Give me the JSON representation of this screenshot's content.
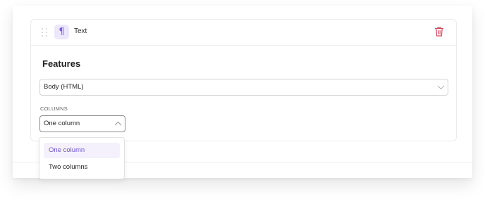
{
  "block": {
    "type_icon": "paragraph-icon",
    "type_label": "Text",
    "delete_icon": "trash-icon"
  },
  "section": {
    "title": "Features"
  },
  "body_select": {
    "value": "Body (HTML)"
  },
  "columns": {
    "label": "COLUMNS",
    "value": "One column",
    "options": [
      "One column",
      "Two columns"
    ],
    "selected_index": 0
  },
  "colors": {
    "accent": "#7a60d6",
    "accent_bg": "#ece7fb",
    "delete": "#d44a5e",
    "option_active_bg": "#f4f1fd"
  }
}
